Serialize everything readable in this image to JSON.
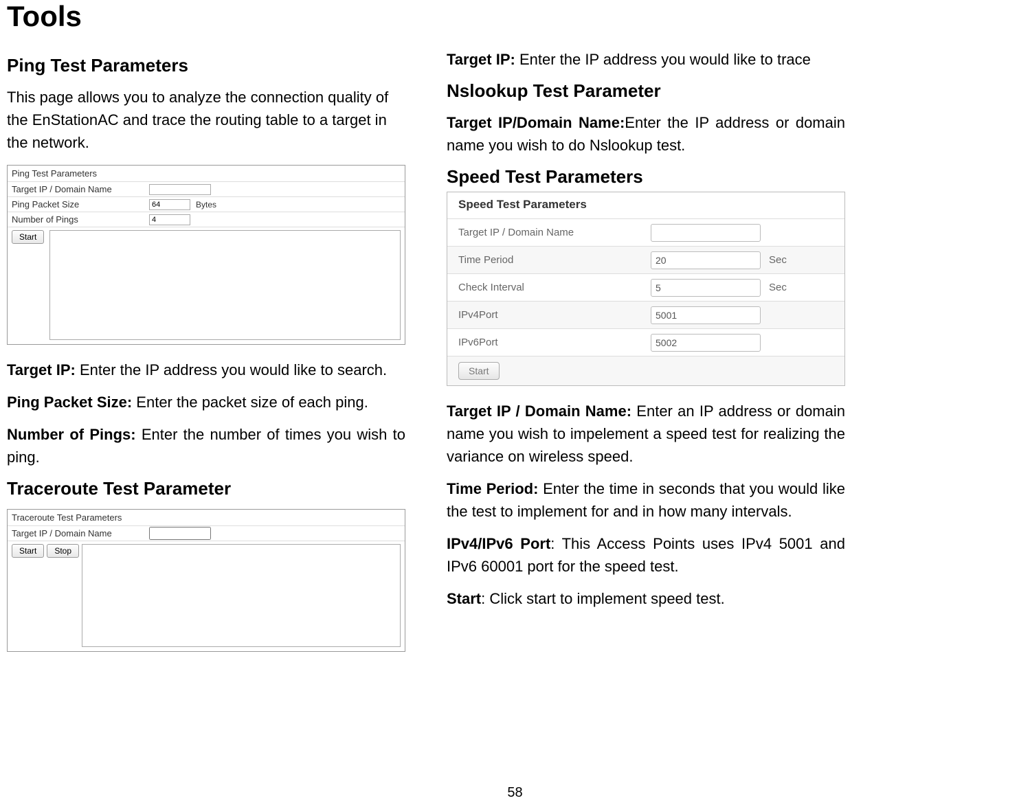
{
  "page_title": "Tools",
  "page_number": "58",
  "left": {
    "section1_heading": "Ping Test Parameters",
    "intro": "This page allows you to analyze the connection quality of the EnStationAC and trace the routing table to a target in the network.",
    "ping_panel": {
      "title": "Ping Test Parameters",
      "row_target_label": "Target IP / Domain Name",
      "row_size_label": "Ping Packet Size",
      "row_size_value": "64",
      "row_size_unit": "Bytes",
      "row_count_label": "Number of Pings",
      "row_count_value": "4",
      "start_label": "Start"
    },
    "defs": {
      "target_ip_bold": "Target IP:",
      "target_ip_text": " Enter the IP address you would like to search.",
      "packet_size_bold": "Ping Packet Size:",
      "packet_size_text": " Enter the packet size of each ping.",
      "num_pings_bold": "Number of Pings:",
      "num_pings_text": " Enter the number of times you wish to ping."
    },
    "section2_heading": "Traceroute Test Parameter",
    "trace_panel": {
      "title": "Traceroute Test Parameters",
      "row_target_label": "Target IP / Domain Name",
      "start_label": "Start",
      "stop_label": "Stop"
    }
  },
  "right": {
    "defs1": {
      "target_ip_bold": "Target IP:",
      "target_ip_text": " Enter the IP address you would like to trace"
    },
    "section3_heading": "Nslookup Test Parameter",
    "defs2": {
      "nslookup_bold": "Target IP/Domain Name:",
      "nslookup_text": "Enter the IP address or domain name you wish to do Nslookup test."
    },
    "section4_heading": "Speed Test Parameters",
    "speed_panel": {
      "title": "Speed Test Parameters",
      "row_target_label": "Target IP / Domain Name",
      "row_time_label": "Time Period",
      "row_time_value": "20",
      "row_time_unit": "Sec",
      "row_interval_label": "Check Interval",
      "row_interval_value": "5",
      "row_interval_unit": "Sec",
      "row_ipv4_label": "IPv4Port",
      "row_ipv4_value": "5001",
      "row_ipv6_label": "IPv6Port",
      "row_ipv6_value": "5002",
      "start_label": "Start"
    },
    "defs3": {
      "target_bold": "Target IP / Domain Name:",
      "target_text": " Enter an IP address or domain name you wish to impelement a speed test for realizing the variance on wireless speed.",
      "time_bold": "Time Period:",
      "time_text": " Enter the time in seconds that you would like the test to implement for and in how many intervals.",
      "port_bold": "IPv4/IPv6 Port",
      "port_text": ": This Access Points uses IPv4 5001 and IPv6 60001 port for the speed test.",
      "start_bold": "Start",
      "start_text": ": Click start to implement speed test."
    }
  }
}
